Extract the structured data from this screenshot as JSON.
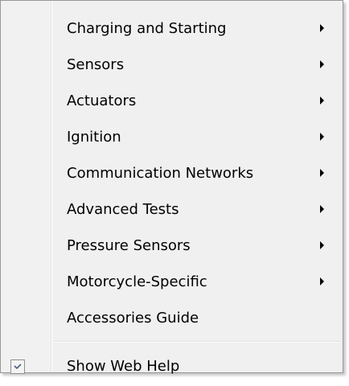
{
  "menu": {
    "items": [
      {
        "label": "Charging and Starting",
        "submenu": true
      },
      {
        "label": "Sensors",
        "submenu": true
      },
      {
        "label": "Actuators",
        "submenu": true
      },
      {
        "label": "Ignition",
        "submenu": true
      },
      {
        "label": "Communication Networks",
        "submenu": true
      },
      {
        "label": "Advanced Tests",
        "submenu": true
      },
      {
        "label": "Pressure Sensors",
        "submenu": true
      },
      {
        "label": "Motorcycle-Specific",
        "submenu": true
      },
      {
        "label": "Accessories Guide",
        "submenu": false
      }
    ],
    "toggle_item": {
      "label": "Show Web Help",
      "checked": true,
      "icon": "checkbox-checked-icon"
    }
  }
}
